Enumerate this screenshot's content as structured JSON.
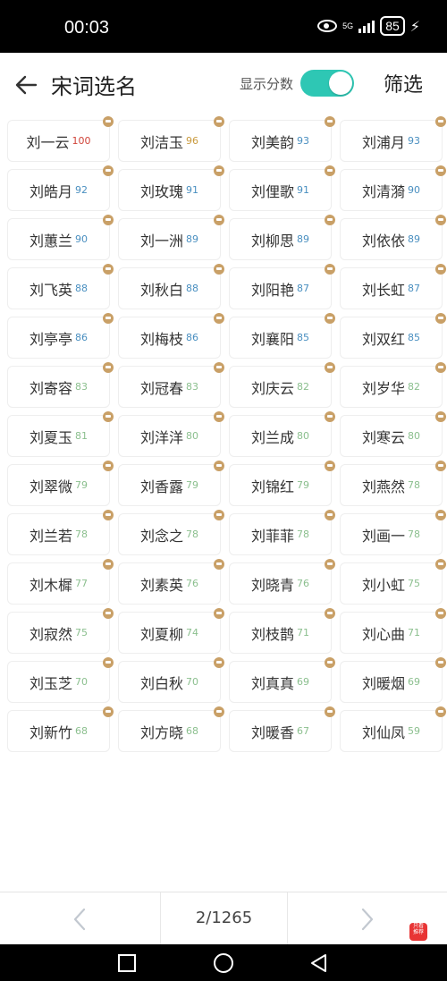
{
  "status": {
    "time": "00:03",
    "network": "5G",
    "battery": "85"
  },
  "header": {
    "title": "宋词选名",
    "score_label": "显示分数",
    "filter": "筛选",
    "show_scores": true
  },
  "names": [
    {
      "name": "刘一云",
      "score": "100",
      "color": "#d0443a"
    },
    {
      "name": "刘洁玉",
      "score": "96",
      "color": "#c99a3e"
    },
    {
      "name": "刘美韵",
      "score": "93",
      "color": "#4a8fc0"
    },
    {
      "name": "刘浦月",
      "score": "93",
      "color": "#4a8fc0"
    },
    {
      "name": "刘皓月",
      "score": "92",
      "color": "#4a8fc0"
    },
    {
      "name": "刘玫瑰",
      "score": "91",
      "color": "#4a8fc0"
    },
    {
      "name": "刘俚歌",
      "score": "91",
      "color": "#4a8fc0"
    },
    {
      "name": "刘清漪",
      "score": "90",
      "color": "#4a8fc0"
    },
    {
      "name": "刘蕙兰",
      "score": "90",
      "color": "#4a8fc0"
    },
    {
      "name": "刘一洲",
      "score": "89",
      "color": "#4a8fc0"
    },
    {
      "name": "刘柳思",
      "score": "89",
      "color": "#4a8fc0"
    },
    {
      "name": "刘依依",
      "score": "89",
      "color": "#4a8fc0"
    },
    {
      "name": "刘飞英",
      "score": "88",
      "color": "#4a8fc0"
    },
    {
      "name": "刘秋白",
      "score": "88",
      "color": "#4a8fc0"
    },
    {
      "name": "刘阳艳",
      "score": "87",
      "color": "#4a8fc0"
    },
    {
      "name": "刘长虹",
      "score": "87",
      "color": "#4a8fc0"
    },
    {
      "name": "刘亭亭",
      "score": "86",
      "color": "#4a8fc0"
    },
    {
      "name": "刘梅枝",
      "score": "86",
      "color": "#4a8fc0"
    },
    {
      "name": "刘襄阳",
      "score": "85",
      "color": "#4a8fc0"
    },
    {
      "name": "刘双红",
      "score": "85",
      "color": "#4a8fc0"
    },
    {
      "name": "刘寄容",
      "score": "83",
      "color": "#8bbf8e"
    },
    {
      "name": "刘冠春",
      "score": "83",
      "color": "#8bbf8e"
    },
    {
      "name": "刘庆云",
      "score": "82",
      "color": "#8bbf8e"
    },
    {
      "name": "刘岁华",
      "score": "82",
      "color": "#8bbf8e"
    },
    {
      "name": "刘夏玉",
      "score": "81",
      "color": "#8bbf8e"
    },
    {
      "name": "刘洋洋",
      "score": "80",
      "color": "#8bbf8e"
    },
    {
      "name": "刘兰成",
      "score": "80",
      "color": "#8bbf8e"
    },
    {
      "name": "刘寒云",
      "score": "80",
      "color": "#8bbf8e"
    },
    {
      "name": "刘翠微",
      "score": "79",
      "color": "#8bbf8e"
    },
    {
      "name": "刘香露",
      "score": "79",
      "color": "#8bbf8e"
    },
    {
      "name": "刘锦红",
      "score": "79",
      "color": "#8bbf8e"
    },
    {
      "name": "刘燕然",
      "score": "78",
      "color": "#8bbf8e"
    },
    {
      "name": "刘兰若",
      "score": "78",
      "color": "#8bbf8e"
    },
    {
      "name": "刘念之",
      "score": "78",
      "color": "#8bbf8e"
    },
    {
      "name": "刘菲菲",
      "score": "78",
      "color": "#8bbf8e"
    },
    {
      "name": "刘画一",
      "score": "78",
      "color": "#8bbf8e"
    },
    {
      "name": "刘木樨",
      "score": "77",
      "color": "#8bbf8e"
    },
    {
      "name": "刘素英",
      "score": "76",
      "color": "#8bbf8e"
    },
    {
      "name": "刘晓青",
      "score": "76",
      "color": "#8bbf8e"
    },
    {
      "name": "刘小虹",
      "score": "75",
      "color": "#8bbf8e"
    },
    {
      "name": "刘寂然",
      "score": "75",
      "color": "#8bbf8e"
    },
    {
      "name": "刘夏柳",
      "score": "74",
      "color": "#8bbf8e"
    },
    {
      "name": "刘枝鹊",
      "score": "71",
      "color": "#8bbf8e"
    },
    {
      "name": "刘心曲",
      "score": "71",
      "color": "#8bbf8e"
    },
    {
      "name": "刘玉芝",
      "score": "70",
      "color": "#8bbf8e"
    },
    {
      "name": "刘白秋",
      "score": "70",
      "color": "#8bbf8e"
    },
    {
      "name": "刘真真",
      "score": "69",
      "color": "#8bbf8e"
    },
    {
      "name": "刘暖烟",
      "score": "69",
      "color": "#8bbf8e"
    },
    {
      "name": "刘新竹",
      "score": "68",
      "color": "#8bbf8e"
    },
    {
      "name": "刘方晓",
      "score": "68",
      "color": "#8bbf8e"
    },
    {
      "name": "刘暖香",
      "score": "67",
      "color": "#8bbf8e"
    },
    {
      "name": "刘仙凤",
      "score": "59",
      "color": "#8bbf8e"
    }
  ],
  "pager": {
    "page_label": "2/1265",
    "badge": "只看\n推荐"
  },
  "colors": {
    "accent": "#2ec7b4",
    "crown": "#c9a067"
  }
}
